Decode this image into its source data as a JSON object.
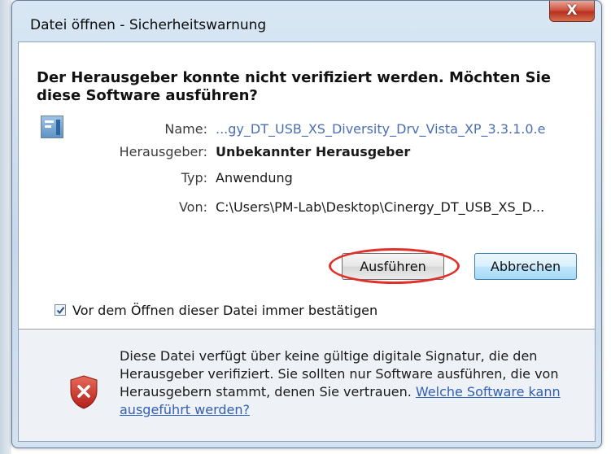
{
  "window": {
    "title": "Datei öffnen - Sicherheitswarnung",
    "close_label": "X"
  },
  "heading": "Der Herausgeber konnte nicht verifiziert werden. Möchten Sie diese Software ausführen?",
  "file_info": {
    "icon": "application-file-icon",
    "rows": [
      {
        "label": "Name:",
        "value": "...gy_DT_USB_XS_Diversity_Drv_Vista_XP_3.3.1.0.e"
      },
      {
        "label": "Herausgeber:",
        "value": "Unbekannter Herausgeber"
      },
      {
        "label": "Typ:",
        "value": "Anwendung"
      },
      {
        "label": "Von:",
        "value": "C:\\Users\\PM-Lab\\Desktop\\Cinergy_DT_USB_XS_D..."
      }
    ]
  },
  "buttons": {
    "run": "Ausführen",
    "cancel": "Abbrechen"
  },
  "checkbox": {
    "label": "Vor dem Öffnen dieser Datei immer bestätigen",
    "checked": true
  },
  "footer": {
    "icon": "shield-error-icon",
    "text": "Diese Datei verfügt über keine gültige digitale Signatur, die den Herausgeber verifiziert. Sie sollten nur Software ausführen, die von Herausgebern stammt, denen Sie vertrauen.",
    "link": "Welche Software kann ausgeführt werden?"
  },
  "colors": {
    "highlight": "#e0302a",
    "link": "#2f60b5",
    "close_button": "#cf5442"
  }
}
